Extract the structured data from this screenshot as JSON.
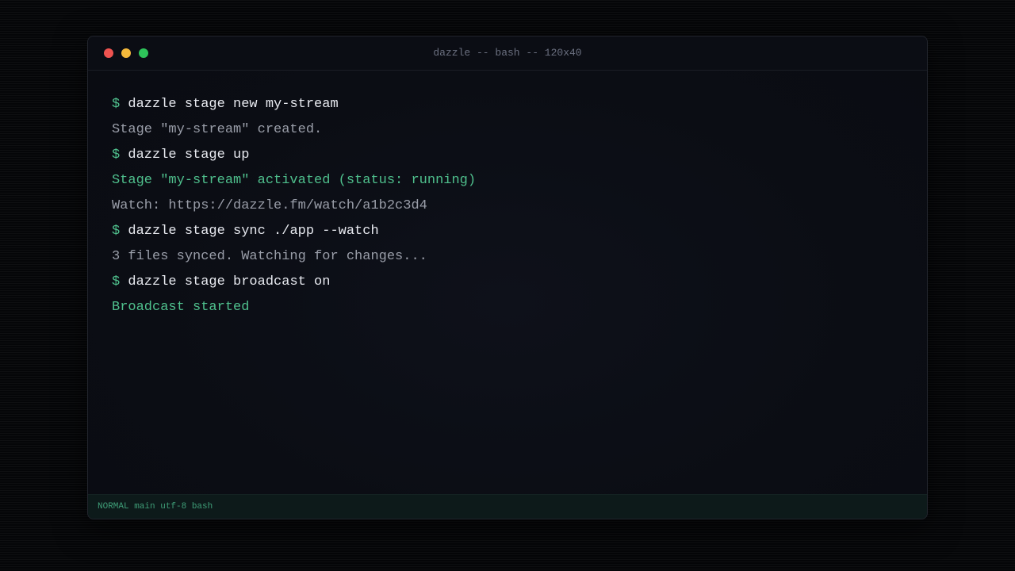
{
  "window": {
    "title": "dazzle -- bash -- 120x40",
    "controls": {
      "close_color": "#ef5350",
      "minimize_color": "#f5b93b",
      "maximize_color": "#2ec45a"
    }
  },
  "terminal": {
    "prompt_symbol": "$",
    "lines": [
      {
        "kind": "command",
        "text": "dazzle stage new my-stream"
      },
      {
        "kind": "output",
        "text": "Stage \"my-stream\" created."
      },
      {
        "kind": "command",
        "text": "dazzle stage up"
      },
      {
        "kind": "success",
        "text": "Stage \"my-stream\" activated (status: running)"
      },
      {
        "kind": "output",
        "text": "Watch: https://dazzle.fm/watch/a1b2c3d4"
      },
      {
        "kind": "command",
        "text": "dazzle stage sync ./app --watch"
      },
      {
        "kind": "output",
        "text": "3 files synced. Watching for changes..."
      },
      {
        "kind": "command",
        "text": "dazzle stage broadcast on"
      },
      {
        "kind": "success",
        "text": "Broadcast started"
      }
    ]
  },
  "statusbar": {
    "text": "NORMAL main utf-8 bash"
  },
  "colors": {
    "prompt": "#4fc08d",
    "command": "#e8eaf0",
    "output": "#9a9ea9",
    "success": "#4fc08d",
    "status": "#3f9e78"
  }
}
